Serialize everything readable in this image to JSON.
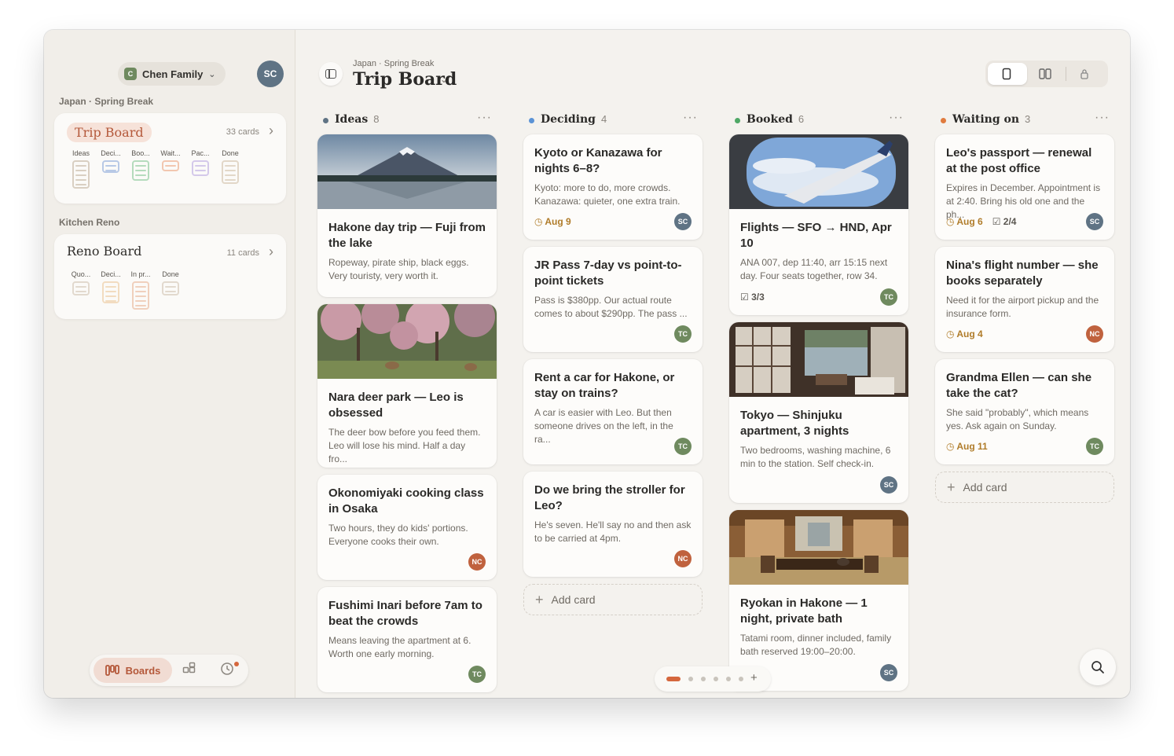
{
  "sidebar": {
    "family": {
      "badge": "C",
      "name": "Chen Family"
    },
    "avatar": "SC",
    "groups": [
      {
        "label": "Japan · Spring Break",
        "board": {
          "title": "Trip Board",
          "count": "33 cards",
          "columns": [
            {
              "label": "Ideas",
              "color": "#d9cfc2"
            },
            {
              "label": "Deci...",
              "color": "#b8c9e6"
            },
            {
              "label": "Boo...",
              "color": "#b5dbbd"
            },
            {
              "label": "Wait...",
              "color": "#f2c7b0"
            },
            {
              "label": "Pac...",
              "color": "#d4c9ea"
            },
            {
              "label": "Done",
              "color": "#e2d7c8"
            }
          ]
        }
      },
      {
        "label": "Kitchen Reno",
        "board": {
          "title": "Reno Board",
          "count": "11 cards",
          "columns": [
            {
              "label": "Quo...",
              "color": "#e2d9ce"
            },
            {
              "label": "Deci...",
              "color": "#f2dcc0"
            },
            {
              "label": "In pr...",
              "color": "#f0d0bd"
            },
            {
              "label": "Done",
              "color": "#e2d9ce"
            }
          ]
        }
      }
    ],
    "nav": {
      "boards_label": "Boards"
    }
  },
  "header": {
    "breadcrumb": "Japan · Spring Break",
    "title": "Trip Board"
  },
  "columns": [
    {
      "name": "Ideas",
      "count": "8",
      "color": "#5f7384",
      "cards": [
        {
          "title": "Hakone day trip — Fuji from the lake",
          "desc": "Ropeway, pirate ship, black eggs. Very touristy, very worth it.",
          "image": "fuji-lake"
        },
        {
          "title": "Nara deer park — Leo is obsessed",
          "desc": "The deer bow before you feed them. Leo will lose his mind. Half a day fro...",
          "image": "deer-park"
        },
        {
          "title": "Okonomiyaki cooking class in Osaka",
          "desc": "Two hours, they do kids' portions. Everyone cooks their own.",
          "avatar": "NC"
        },
        {
          "title": "Fushimi Inari before 7am to beat the crowds",
          "desc": "Means leaving the apartment at 6. Worth one early morning.",
          "avatar": "TC"
        }
      ]
    },
    {
      "name": "Deciding",
      "count": "4",
      "color": "#5b93d6",
      "cards": [
        {
          "title": "Kyoto or Kanazawa for nights 6–8?",
          "desc": "Kyoto: more to do, more crowds. Kanazawa: quieter, one extra train.",
          "date": "Aug 9",
          "avatar": "SC"
        },
        {
          "title": "JR Pass 7-day vs point-to-point tickets",
          "desc": "Pass is $380pp. Our actual route comes to about $290pp. The pass ...",
          "avatar": "TC"
        },
        {
          "title": "Rent a car for Hakone, or stay on trains?",
          "desc": "A car is easier with Leo. But then someone drives on the left, in the ra...",
          "avatar": "TC"
        },
        {
          "title": "Do we bring the stroller for Leo?",
          "desc": "He's seven. He'll say no and then ask to be carried at 4pm.",
          "avatar": "NC"
        }
      ],
      "add": "Add card"
    },
    {
      "name": "Booked",
      "count": "6",
      "color": "#4fa866",
      "cards": [
        {
          "title": "Flights — SFO → HND, Apr 10",
          "desc": "ANA 007, dep 11:40, arr 15:15 next day. Four seats together, row 34.",
          "check": "3/3",
          "avatar": "TC",
          "image": "plane-wing"
        },
        {
          "title": "Tokyo — Shinjuku apartment, 3 nights",
          "desc": "Two bedrooms, washing machine, 6 min to the station. Self check-in.",
          "avatar": "SC",
          "image": "apartment"
        },
        {
          "title": "Ryokan in Hakone — 1 night, private bath",
          "desc": "Tatami room, dinner included, family bath reserved 19:00–20:00.",
          "avatar": "SC",
          "image": "ryokan"
        }
      ]
    },
    {
      "name": "Waiting on",
      "count": "3",
      "color": "#e07b3e",
      "cards": [
        {
          "title": "Leo's passport — renewal at the post office",
          "desc": "Expires in December. Appointment is at 2:40. Bring his old one and the ph...",
          "date": "Aug 6",
          "check": "2/4",
          "avatar": "SC"
        },
        {
          "title": "Nina's flight number — she books separately",
          "desc": "Need it for the airport pickup and the insurance form.",
          "date": "Aug 4",
          "avatar": "NC"
        },
        {
          "title": "Grandma Ellen — can she take the cat?",
          "desc": "She said \"probably\", which means yes. Ask again on Sunday.",
          "date": "Aug 11",
          "avatar": "TC"
        }
      ],
      "add": "Add card"
    }
  ],
  "avatar_colors": {
    "SC": "#5f7384",
    "TC": "#6f8a5f",
    "NC": "#c0623e"
  }
}
